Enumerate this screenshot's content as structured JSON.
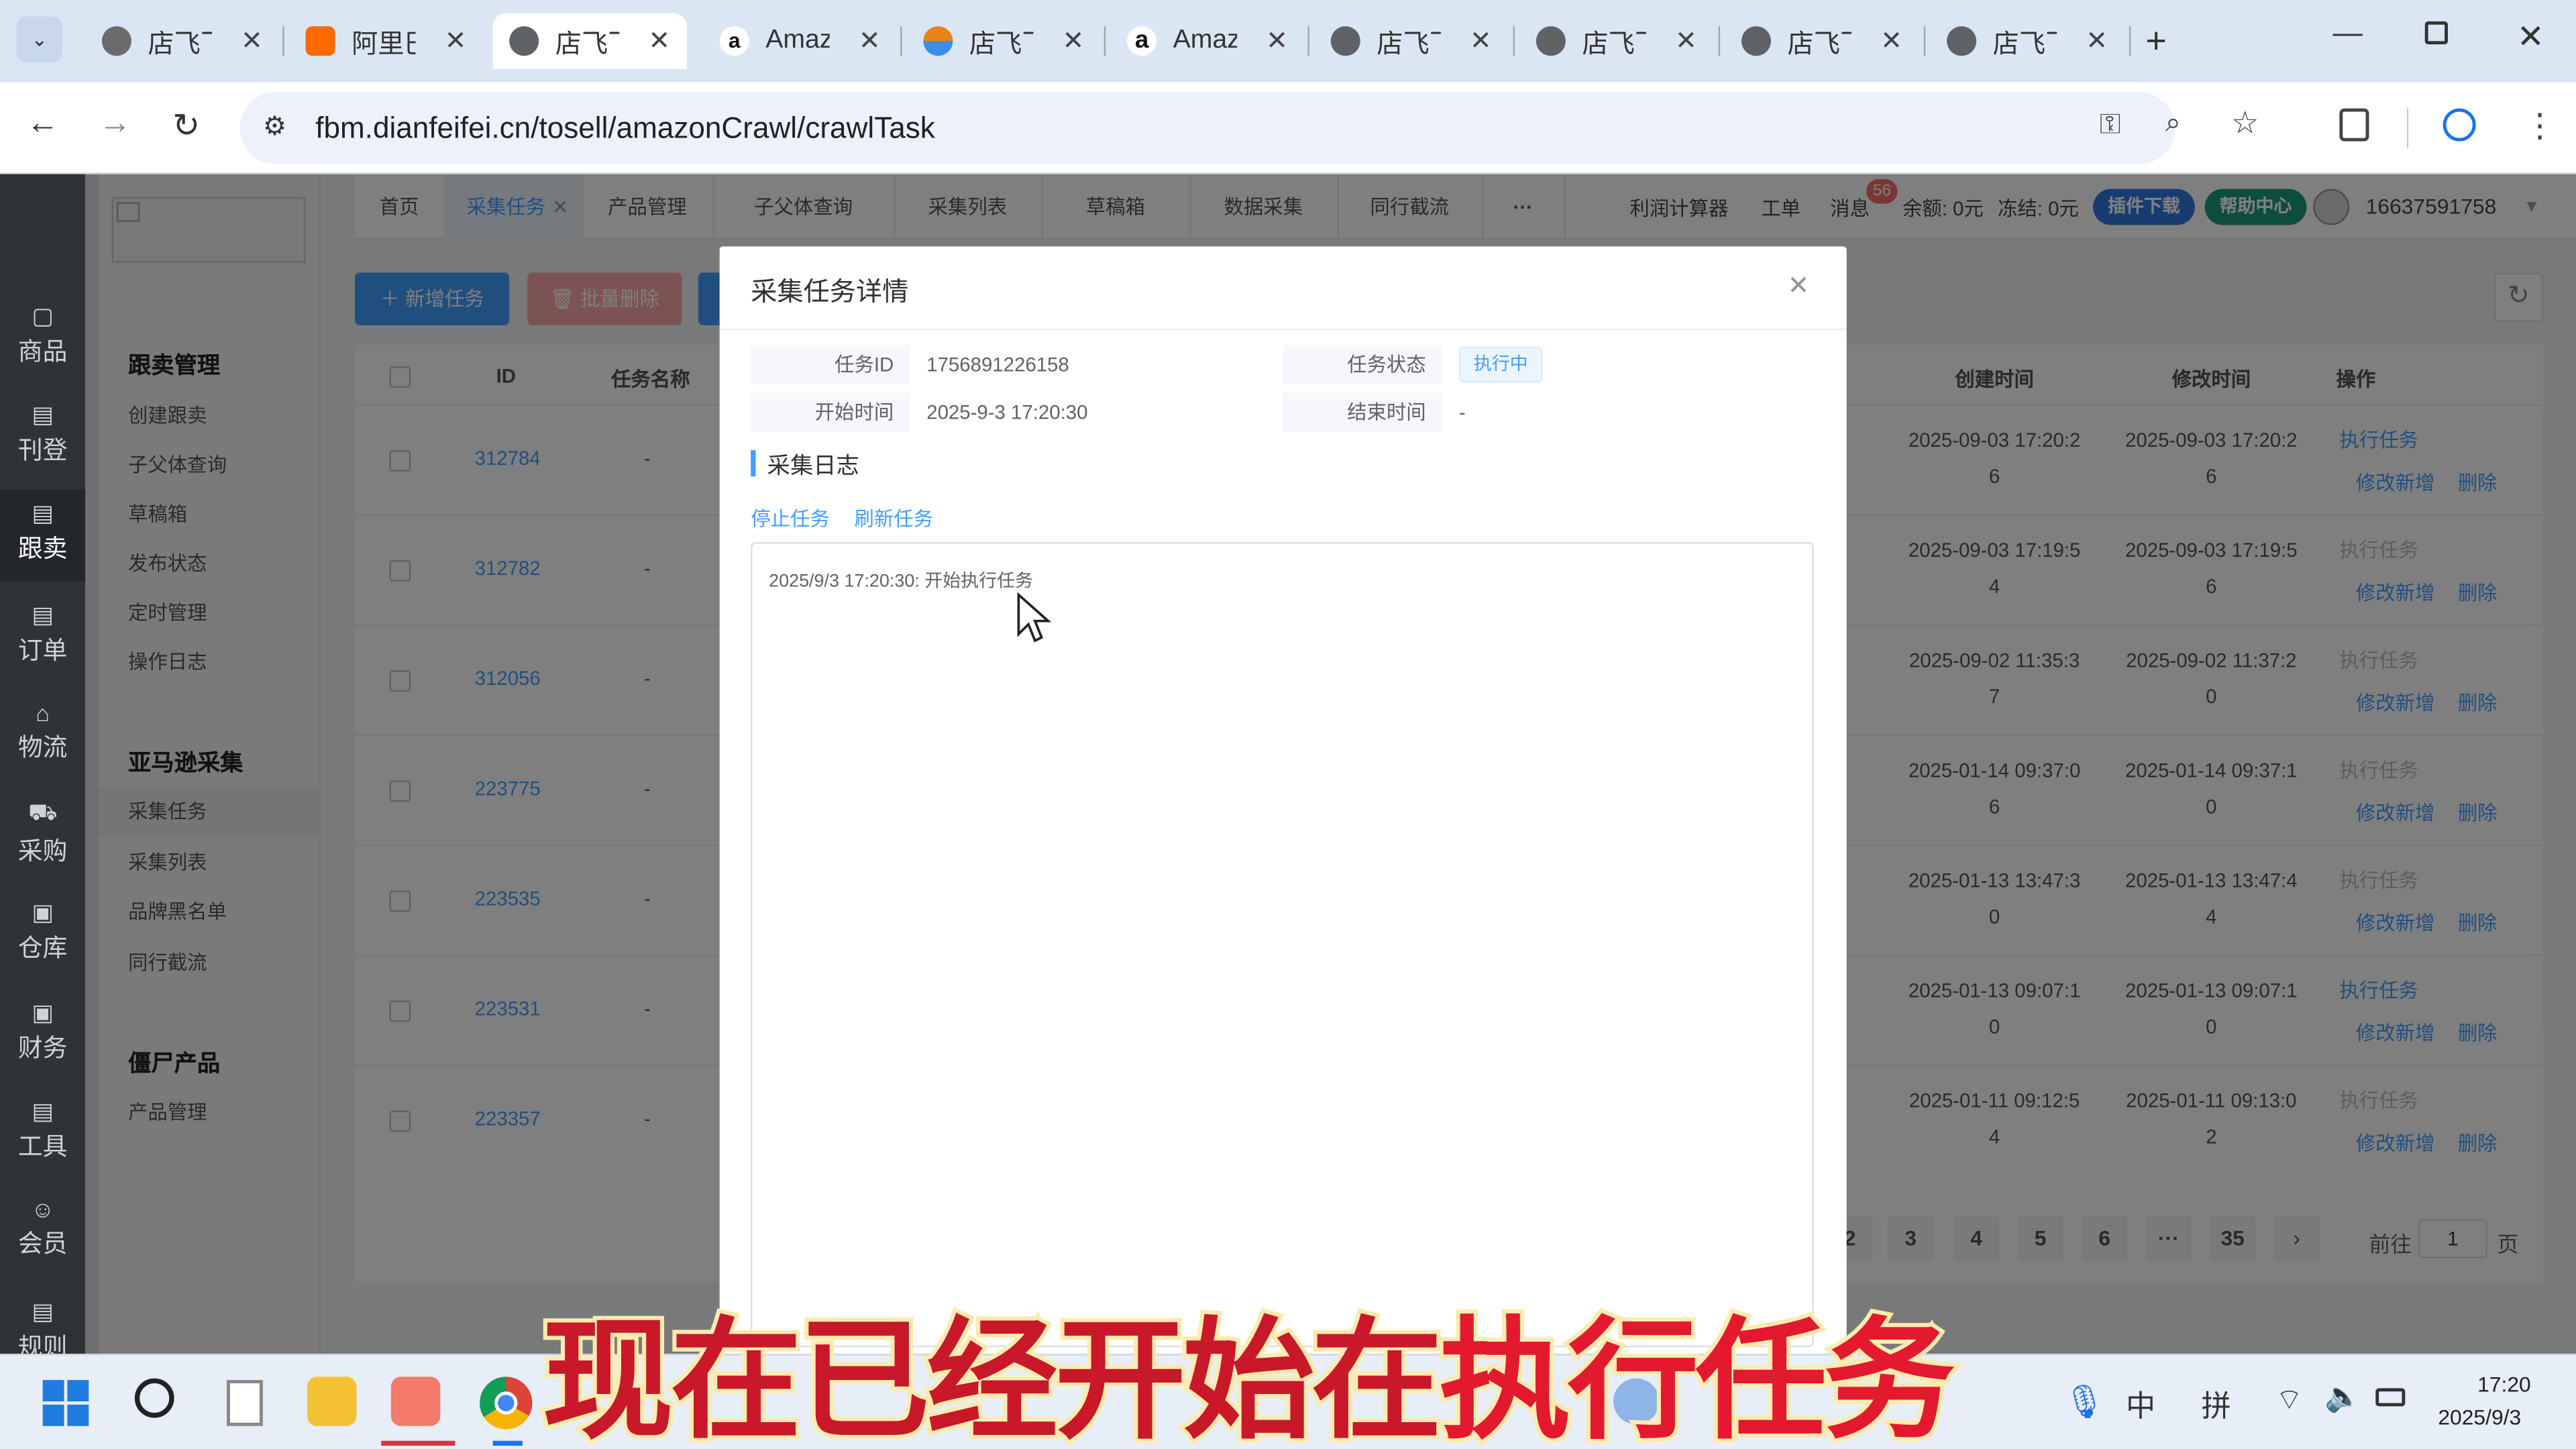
{
  "browser": {
    "tabs": [
      {
        "label": "店飞飞",
        "icon": "dianfeifei-icon",
        "color": "#6b6b6b"
      },
      {
        "label": "阿里巴巴",
        "icon": "alibaba-icon",
        "color": "#ff6a00"
      },
      {
        "label": "店飞飞",
        "icon": "globe-icon",
        "color": "#5f6368",
        "active": true
      },
      {
        "label": "Amazon",
        "icon": "amazon-icon",
        "color": "#1a1a1a"
      },
      {
        "label": "店飞飞",
        "icon": "dianfeifei-color-icon",
        "color": "#e8841a"
      },
      {
        "label": "Amazon",
        "icon": "amazon-icon",
        "color": "#1a1a1a"
      },
      {
        "label": "店飞飞",
        "icon": "globe-icon",
        "color": "#5f6368"
      },
      {
        "label": "店飞飞",
        "icon": "globe-icon",
        "color": "#5f6368"
      },
      {
        "label": "店飞飞",
        "icon": "globe-icon",
        "color": "#5f6368"
      },
      {
        "label": "店飞飞",
        "icon": "globe-icon",
        "color": "#5f6368"
      }
    ],
    "url": "fbm.dianfeifei.cn/tosell/amazonCrawl/crawlTask"
  },
  "rail": [
    {
      "label": "商品",
      "icon": "goods-icon"
    },
    {
      "label": "刊登",
      "icon": "publish-icon"
    },
    {
      "label": "跟卖",
      "icon": "follow-sell-icon",
      "active": true
    },
    {
      "label": "订单",
      "icon": "order-icon"
    },
    {
      "label": "物流",
      "icon": "logistics-icon"
    },
    {
      "label": "采购",
      "icon": "cart-icon"
    },
    {
      "label": "仓库",
      "icon": "warehouse-icon"
    },
    {
      "label": "财务",
      "icon": "finance-icon"
    },
    {
      "label": "工具",
      "icon": "tools-icon"
    },
    {
      "label": "会员",
      "icon": "member-icon"
    },
    {
      "label": "规则",
      "icon": "rules-icon"
    }
  ],
  "sidemenu": {
    "group1": {
      "title": "跟卖管理",
      "items": [
        "创建跟卖",
        "子父体查询",
        "草稿箱",
        "发布状态",
        "定时管理",
        "操作日志"
      ]
    },
    "group2": {
      "title": "亚马逊采集",
      "items": [
        "采集任务",
        "采集列表",
        "品牌黑名单",
        "同行截流"
      ]
    },
    "group3": {
      "title": "僵尸产品",
      "items": [
        "产品管理"
      ]
    }
  },
  "topnav": {
    "tabs": [
      "首页",
      "采集任务",
      "产品管理",
      "子父体查询",
      "采集列表",
      "草稿箱",
      "数据采集",
      "同行截流",
      "···"
    ],
    "right": {
      "calculator": "利润计算器",
      "ticket": "工单",
      "message": "消息",
      "message_badge": "56",
      "balance": "余额: 0元",
      "frozen": "冻结: 0元",
      "plugin_download": "插件下载",
      "help_center": "帮助中心",
      "phone": "16637591758"
    }
  },
  "toolbar": {
    "add_task": "新增任务",
    "batch_delete": "批量删除"
  },
  "table": {
    "headers": {
      "id": "ID",
      "name": "任务名称",
      "created": "创建时间",
      "modified": "修改时间",
      "ops": "操作"
    },
    "rows": [
      {
        "id": "312784",
        "name": "-",
        "created": [
          "2025-09-03 17:20:2",
          "6"
        ],
        "modified": [
          "2025-09-03 17:20:2",
          "6"
        ],
        "exec": "执行任务",
        "exec_enabled": true,
        "edit": "修改新增",
        "del": "删除"
      },
      {
        "id": "312782",
        "name": "-",
        "created": [
          "2025-09-03 17:19:5",
          "4"
        ],
        "modified": [
          "2025-09-03 17:19:5",
          "6"
        ],
        "exec": "执行任务",
        "exec_enabled": false,
        "edit": "修改新增",
        "del": "删除"
      },
      {
        "id": "312056",
        "name": "-",
        "created": [
          "2025-09-02 11:35:3",
          "7"
        ],
        "modified": [
          "2025-09-02 11:37:2",
          "0"
        ],
        "exec": "执行任务",
        "exec_enabled": false,
        "edit": "修改新增",
        "del": "删除"
      },
      {
        "id": "223775",
        "name": "-",
        "created": [
          "2025-01-14 09:37:0",
          "6"
        ],
        "modified": [
          "2025-01-14 09:37:1",
          "0"
        ],
        "exec": "执行任务",
        "exec_enabled": false,
        "edit": "修改新增",
        "del": "删除"
      },
      {
        "id": "223535",
        "name": "-",
        "created": [
          "2025-01-13 13:47:3",
          "0"
        ],
        "modified": [
          "2025-01-13 13:47:4",
          "4"
        ],
        "exec": "执行任务",
        "exec_enabled": false,
        "edit": "修改新增",
        "del": "删除"
      },
      {
        "id": "223531",
        "name": "-",
        "created": [
          "2025-01-13 09:07:1",
          "0"
        ],
        "modified": [
          "2025-01-13 09:07:1",
          "0"
        ],
        "exec": "执行任务",
        "exec_enabled": true,
        "edit": "修改新增",
        "del": "删除"
      },
      {
        "id": "223357",
        "name": "-",
        "created": [
          "2025-01-11 09:12:5",
          "4"
        ],
        "modified": [
          "2025-01-11 09:13:0",
          "2"
        ],
        "exec": "执行任务",
        "exec_enabled": false,
        "edit": "修改新增",
        "del": "删除"
      }
    ]
  },
  "pagination": {
    "pages": [
      "2",
      "3",
      "4",
      "5",
      "6",
      "···",
      "35"
    ],
    "goto_label": "前往",
    "goto_value": "1",
    "page_suffix": "页"
  },
  "modal": {
    "title": "采集任务详情",
    "task_id_label": "任务ID",
    "task_id": "1756891226158",
    "status_label": "任务状态",
    "status": "执行中",
    "start_label": "开始时间",
    "start": "2025-9-3 17:20:30",
    "end_label": "结束时间",
    "end": "-",
    "log_section": "采集日志",
    "stop": "停止任务",
    "refresh": "刷新任务",
    "log_line": "2025/9/3 17:20:30: 开始执行任务"
  },
  "taskbar": {
    "ime1": "中",
    "ime2": "拼",
    "time": "17:20",
    "date": "2025/9/3"
  },
  "subtitle": {
    "part1": "现在已经开始在",
    "part2": "执行任务"
  }
}
